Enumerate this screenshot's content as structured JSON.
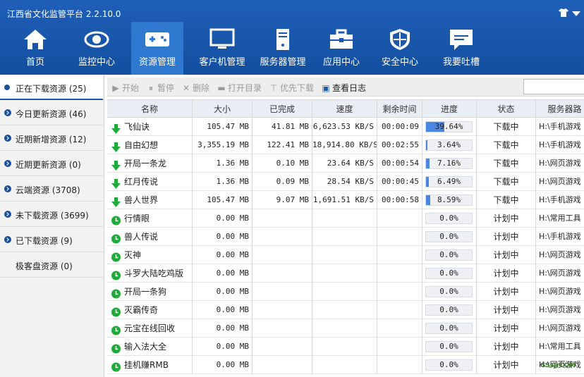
{
  "app": {
    "title": "江西省文化监管平台 2.2.10.0"
  },
  "nav": [
    {
      "label": "首页",
      "icon": "home-icon"
    },
    {
      "label": "监控中心",
      "icon": "eye-icon"
    },
    {
      "label": "资源管理",
      "icon": "gamepad-icon",
      "active": true
    },
    {
      "label": "客户机管理",
      "icon": "monitor-icon"
    },
    {
      "label": "服务器管理",
      "icon": "server-icon"
    },
    {
      "label": "应用中心",
      "icon": "toolbox-icon"
    },
    {
      "label": "安全中心",
      "icon": "shield-icon"
    },
    {
      "label": "我要吐槽",
      "icon": "chat-icon"
    }
  ],
  "sidebar": [
    {
      "label": "正在下载资源 (25)",
      "active": true
    },
    {
      "label": "今日更新资源 (46)"
    },
    {
      "label": "近期新增资源 (12)"
    },
    {
      "label": "近期更新资源 (0)"
    },
    {
      "label": "云端资源 (3708)"
    },
    {
      "label": "未下载资源 (3699)"
    },
    {
      "label": "已下载资源 (9)"
    },
    {
      "label": "极客盘资源 (0)"
    }
  ],
  "toolbar": {
    "start": "开始",
    "pause": "暂停",
    "delete": "删除",
    "open_dir": "打开目录",
    "priority": "优先下载",
    "view_log": "查看日志"
  },
  "table": {
    "headers": [
      "名称",
      "大小",
      "已完成",
      "速度",
      "剩余时间",
      "进度",
      "状态",
      "服务器路"
    ],
    "rows": [
      {
        "name": "飞仙诀",
        "size": "105.47 MB",
        "done": "41.81 MB",
        "speed": "6,623.53 KB/S",
        "remain": "00:00:09",
        "progress": 39.64,
        "progress_text": "39.64%",
        "status": "下载中",
        "path": "H:\\手机游戏",
        "type": "downloading"
      },
      {
        "name": "自由幻想",
        "size": "3,355.19 MB",
        "done": "122.41 MB",
        "speed": "18,914.80 KB/S",
        "remain": "00:02:55",
        "progress": 3.64,
        "progress_text": "3.64%",
        "status": "下载中",
        "path": "H:\\手机游戏",
        "type": "downloading"
      },
      {
        "name": "开局一条龙",
        "size": "1.36 MB",
        "done": "0.10 MB",
        "speed": "23.64 KB/S",
        "remain": "00:00:54",
        "progress": 7.16,
        "progress_text": "7.16%",
        "status": "下载中",
        "path": "H:\\网页游戏",
        "type": "downloading"
      },
      {
        "name": "红月传说",
        "size": "1.36 MB",
        "done": "0.09 MB",
        "speed": "28.54 KB/S",
        "remain": "00:00:45",
        "progress": 6.49,
        "progress_text": "6.49%",
        "status": "下载中",
        "path": "H:\\网页游戏",
        "type": "downloading"
      },
      {
        "name": "兽人世界",
        "size": "105.47 MB",
        "done": "9.07 MB",
        "speed": "1,691.51 KB/S",
        "remain": "00:00:58",
        "progress": 8.59,
        "progress_text": "8.59%",
        "status": "下载中",
        "path": "H:\\手机游戏",
        "type": "downloading"
      },
      {
        "name": "行情眼",
        "size": "0.00 MB",
        "done": "",
        "speed": "",
        "remain": "",
        "progress": 0,
        "progress_text": "0.0%",
        "status": "计划中",
        "path": "H:\\常用工具",
        "type": "planned"
      },
      {
        "name": "兽人传说",
        "size": "0.00 MB",
        "done": "",
        "speed": "",
        "remain": "",
        "progress": 0,
        "progress_text": "0.0%",
        "status": "计划中",
        "path": "H:\\手机游戏",
        "type": "planned"
      },
      {
        "name": "灭神",
        "size": "0.00 MB",
        "done": "",
        "speed": "",
        "remain": "",
        "progress": 0,
        "progress_text": "0.0%",
        "status": "计划中",
        "path": "H:\\网页游戏",
        "type": "planned"
      },
      {
        "name": "斗罗大陆吃鸡版",
        "size": "0.00 MB",
        "done": "",
        "speed": "",
        "remain": "",
        "progress": 0,
        "progress_text": "0.0%",
        "status": "计划中",
        "path": "H:\\网页游戏",
        "type": "planned"
      },
      {
        "name": "开局一条狗",
        "size": "0.00 MB",
        "done": "",
        "speed": "",
        "remain": "",
        "progress": 0,
        "progress_text": "0.0%",
        "status": "计划中",
        "path": "H:\\网页游戏",
        "type": "planned"
      },
      {
        "name": "灭霸传奇",
        "size": "0.00 MB",
        "done": "",
        "speed": "",
        "remain": "",
        "progress": 0,
        "progress_text": "0.0%",
        "status": "计划中",
        "path": "H:\\网页游戏",
        "type": "planned"
      },
      {
        "name": "元宝在线回收",
        "size": "0.00 MB",
        "done": "",
        "speed": "",
        "remain": "",
        "progress": 0,
        "progress_text": "0.0%",
        "status": "计划中",
        "path": "H:\\网页游戏",
        "type": "planned"
      },
      {
        "name": "输入法大全",
        "size": "0.00 MB",
        "done": "",
        "speed": "",
        "remain": "",
        "progress": 0,
        "progress_text": "0.0%",
        "status": "计划中",
        "path": "H:\\常用工具",
        "type": "planned"
      },
      {
        "name": "挂机赚RMB",
        "size": "0.00 MB",
        "done": "",
        "speed": "",
        "remain": "",
        "progress": 0,
        "progress_text": "0.0%",
        "status": "计划中",
        "path": "H:\\网页游戏",
        "type": "planned"
      }
    ]
  },
  "watermark": "GSsJrCOM",
  "colors": {
    "header": "#1a57ad",
    "active_nav": "#2e78cf",
    "progress": "#4b86e0",
    "icon_green": "#1faa3a"
  }
}
